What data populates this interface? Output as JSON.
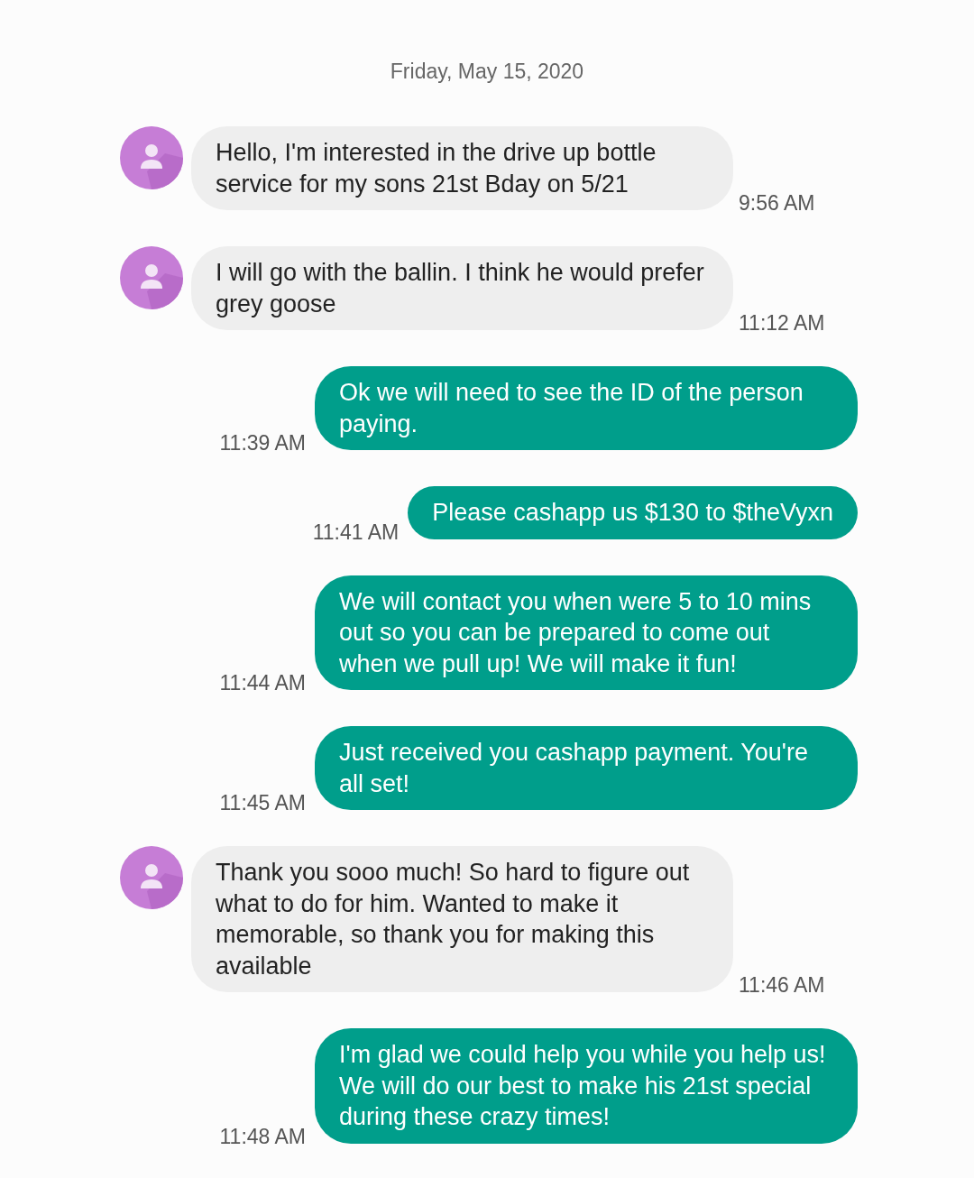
{
  "date": "Friday, May 15, 2020",
  "messages": [
    {
      "kind": "incoming",
      "text": "Hello, I'm interested in the drive up bottle service for my sons 21st Bday on 5/21",
      "time": "9:56 AM"
    },
    {
      "kind": "incoming",
      "text": "I will go with the ballin. I think he would prefer grey goose",
      "time": "11:12 AM"
    },
    {
      "kind": "outgoing",
      "text": "Ok we will need to see the ID of the person paying.",
      "time": "11:39 AM"
    },
    {
      "kind": "outgoing",
      "text": "Please cashapp us $130 to $theVyxn",
      "time": "11:41 AM"
    },
    {
      "kind": "outgoing",
      "text": "We will contact you when were 5 to 10 mins out so you can be prepared to come out when we pull up! We will make it fun!",
      "time": "11:44 AM"
    },
    {
      "kind": "outgoing",
      "text": "Just received you cashapp payment. You're all set!",
      "time": "11:45 AM"
    },
    {
      "kind": "incoming",
      "text": "Thank you sooo much! So hard to figure out what to do for him. Wanted to make it memorable, so thank you for making this available",
      "time": "11:46 AM"
    },
    {
      "kind": "outgoing",
      "text": "I'm glad we could help you while you help us! We will do our best to make his 21st special during these crazy times!",
      "time": "11:48 AM"
    }
  ]
}
